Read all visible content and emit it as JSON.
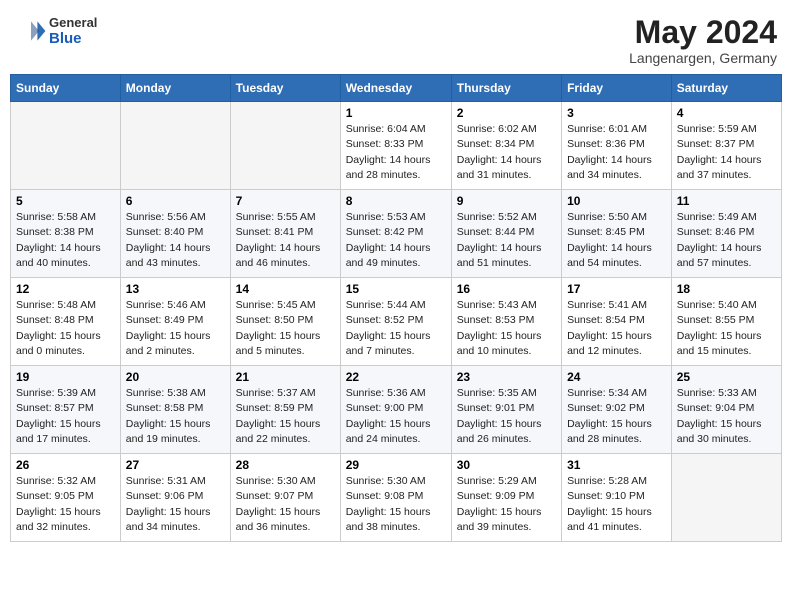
{
  "header": {
    "logo_general": "General",
    "logo_blue": "Blue",
    "month_title": "May 2024",
    "location": "Langenargen, Germany"
  },
  "days_of_week": [
    "Sunday",
    "Monday",
    "Tuesday",
    "Wednesday",
    "Thursday",
    "Friday",
    "Saturday"
  ],
  "weeks": [
    [
      {
        "day": "",
        "info": ""
      },
      {
        "day": "",
        "info": ""
      },
      {
        "day": "",
        "info": ""
      },
      {
        "day": "1",
        "info": "Sunrise: 6:04 AM\nSunset: 8:33 PM\nDaylight: 14 hours\nand 28 minutes."
      },
      {
        "day": "2",
        "info": "Sunrise: 6:02 AM\nSunset: 8:34 PM\nDaylight: 14 hours\nand 31 minutes."
      },
      {
        "day": "3",
        "info": "Sunrise: 6:01 AM\nSunset: 8:36 PM\nDaylight: 14 hours\nand 34 minutes."
      },
      {
        "day": "4",
        "info": "Sunrise: 5:59 AM\nSunset: 8:37 PM\nDaylight: 14 hours\nand 37 minutes."
      }
    ],
    [
      {
        "day": "5",
        "info": "Sunrise: 5:58 AM\nSunset: 8:38 PM\nDaylight: 14 hours\nand 40 minutes."
      },
      {
        "day": "6",
        "info": "Sunrise: 5:56 AM\nSunset: 8:40 PM\nDaylight: 14 hours\nand 43 minutes."
      },
      {
        "day": "7",
        "info": "Sunrise: 5:55 AM\nSunset: 8:41 PM\nDaylight: 14 hours\nand 46 minutes."
      },
      {
        "day": "8",
        "info": "Sunrise: 5:53 AM\nSunset: 8:42 PM\nDaylight: 14 hours\nand 49 minutes."
      },
      {
        "day": "9",
        "info": "Sunrise: 5:52 AM\nSunset: 8:44 PM\nDaylight: 14 hours\nand 51 minutes."
      },
      {
        "day": "10",
        "info": "Sunrise: 5:50 AM\nSunset: 8:45 PM\nDaylight: 14 hours\nand 54 minutes."
      },
      {
        "day": "11",
        "info": "Sunrise: 5:49 AM\nSunset: 8:46 PM\nDaylight: 14 hours\nand 57 minutes."
      }
    ],
    [
      {
        "day": "12",
        "info": "Sunrise: 5:48 AM\nSunset: 8:48 PM\nDaylight: 15 hours\nand 0 minutes."
      },
      {
        "day": "13",
        "info": "Sunrise: 5:46 AM\nSunset: 8:49 PM\nDaylight: 15 hours\nand 2 minutes."
      },
      {
        "day": "14",
        "info": "Sunrise: 5:45 AM\nSunset: 8:50 PM\nDaylight: 15 hours\nand 5 minutes."
      },
      {
        "day": "15",
        "info": "Sunrise: 5:44 AM\nSunset: 8:52 PM\nDaylight: 15 hours\nand 7 minutes."
      },
      {
        "day": "16",
        "info": "Sunrise: 5:43 AM\nSunset: 8:53 PM\nDaylight: 15 hours\nand 10 minutes."
      },
      {
        "day": "17",
        "info": "Sunrise: 5:41 AM\nSunset: 8:54 PM\nDaylight: 15 hours\nand 12 minutes."
      },
      {
        "day": "18",
        "info": "Sunrise: 5:40 AM\nSunset: 8:55 PM\nDaylight: 15 hours\nand 15 minutes."
      }
    ],
    [
      {
        "day": "19",
        "info": "Sunrise: 5:39 AM\nSunset: 8:57 PM\nDaylight: 15 hours\nand 17 minutes."
      },
      {
        "day": "20",
        "info": "Sunrise: 5:38 AM\nSunset: 8:58 PM\nDaylight: 15 hours\nand 19 minutes."
      },
      {
        "day": "21",
        "info": "Sunrise: 5:37 AM\nSunset: 8:59 PM\nDaylight: 15 hours\nand 22 minutes."
      },
      {
        "day": "22",
        "info": "Sunrise: 5:36 AM\nSunset: 9:00 PM\nDaylight: 15 hours\nand 24 minutes."
      },
      {
        "day": "23",
        "info": "Sunrise: 5:35 AM\nSunset: 9:01 PM\nDaylight: 15 hours\nand 26 minutes."
      },
      {
        "day": "24",
        "info": "Sunrise: 5:34 AM\nSunset: 9:02 PM\nDaylight: 15 hours\nand 28 minutes."
      },
      {
        "day": "25",
        "info": "Sunrise: 5:33 AM\nSunset: 9:04 PM\nDaylight: 15 hours\nand 30 minutes."
      }
    ],
    [
      {
        "day": "26",
        "info": "Sunrise: 5:32 AM\nSunset: 9:05 PM\nDaylight: 15 hours\nand 32 minutes."
      },
      {
        "day": "27",
        "info": "Sunrise: 5:31 AM\nSunset: 9:06 PM\nDaylight: 15 hours\nand 34 minutes."
      },
      {
        "day": "28",
        "info": "Sunrise: 5:30 AM\nSunset: 9:07 PM\nDaylight: 15 hours\nand 36 minutes."
      },
      {
        "day": "29",
        "info": "Sunrise: 5:30 AM\nSunset: 9:08 PM\nDaylight: 15 hours\nand 38 minutes."
      },
      {
        "day": "30",
        "info": "Sunrise: 5:29 AM\nSunset: 9:09 PM\nDaylight: 15 hours\nand 39 minutes."
      },
      {
        "day": "31",
        "info": "Sunrise: 5:28 AM\nSunset: 9:10 PM\nDaylight: 15 hours\nand 41 minutes."
      },
      {
        "day": "",
        "info": ""
      }
    ]
  ]
}
